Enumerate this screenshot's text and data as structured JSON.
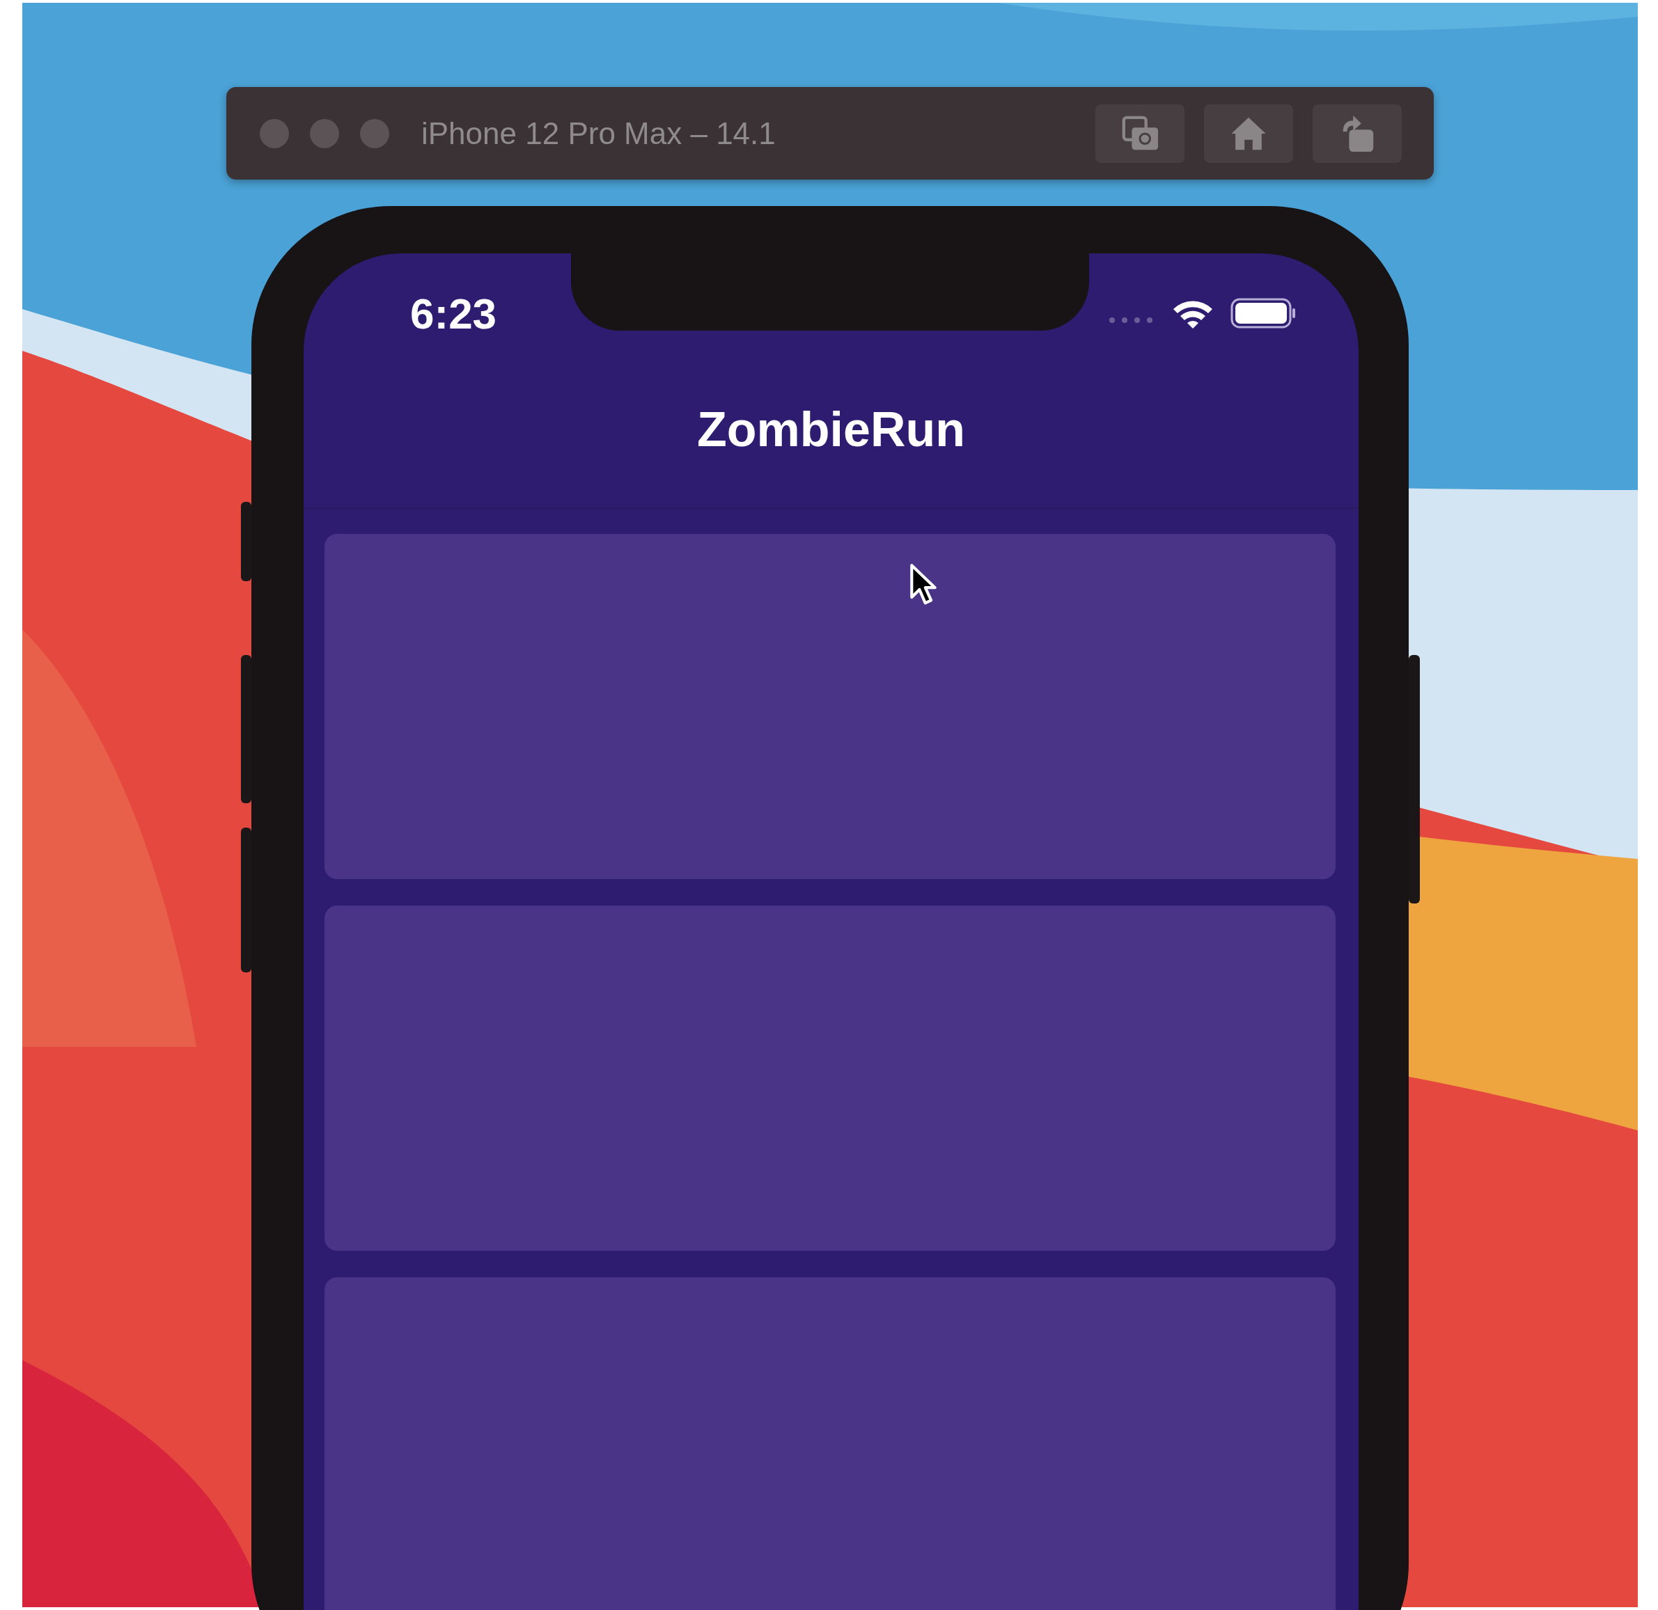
{
  "window": {
    "title": "iPhone 12 Pro Max – 14.1"
  },
  "status_bar": {
    "time": "6:23"
  },
  "nav_bar": {
    "title": "ZombieRun"
  },
  "cards": [
    {
      "kind": "placeholder"
    },
    {
      "kind": "placeholder"
    },
    {
      "kind": "placeholder"
    }
  ]
}
